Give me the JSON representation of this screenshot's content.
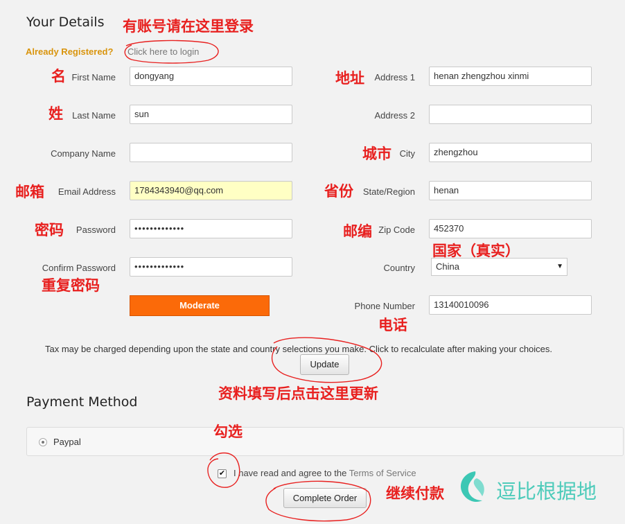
{
  "details": {
    "title": "Your Details",
    "already_registered": "Already Registered?",
    "login_link": "Click here to login"
  },
  "fields_left": {
    "first_name": {
      "label": "First Name",
      "value": "dongyang"
    },
    "last_name": {
      "label": "Last Name",
      "value": "sun"
    },
    "company_name": {
      "label": "Company Name",
      "value": ""
    },
    "email": {
      "label": "Email Address",
      "value": "1784343940@qq.com"
    },
    "password": {
      "label": "Password",
      "value": "•••••••••••••"
    },
    "confirm_password": {
      "label": "Confirm Password",
      "value": "•••••••••••••"
    },
    "strength": "Moderate"
  },
  "fields_right": {
    "address1": {
      "label": "Address 1",
      "value": "henan zhengzhou xinmi"
    },
    "address2": {
      "label": "Address 2",
      "value": ""
    },
    "city": {
      "label": "City",
      "value": "zhengzhou"
    },
    "state": {
      "label": "State/Region",
      "value": "henan"
    },
    "zip": {
      "label": "Zip Code",
      "value": "452370"
    },
    "country": {
      "label": "Country",
      "value": "China"
    },
    "phone": {
      "label": "Phone Number",
      "value": "13140010096"
    }
  },
  "tax_note": "Tax may be charged depending upon the state and country selections you make. Click to recalculate after making your choices.",
  "update_label": "Update",
  "payment": {
    "title": "Payment Method",
    "option": "Paypal"
  },
  "agree": {
    "text": "I have read and agree to the",
    "link": "Terms of Service"
  },
  "complete_label": "Complete Order",
  "annotations": {
    "login": "有账号请在这里登录",
    "first_name": "名",
    "last_name": "姓",
    "email": "邮箱",
    "password": "密码",
    "confirm_password": "重复密码",
    "address": "地址",
    "city": "城市",
    "state": "省份",
    "zip": "邮编",
    "country": "国家（真实）",
    "phone": "电话",
    "update": "资料填写后点击这里更新",
    "check": "勾选",
    "continue": "继续付款"
  },
  "watermark": "逗比根据地",
  "colors": {
    "accent_orange": "#fb6a09",
    "annotation_red": "#e8201f",
    "registered_gold": "#d9940c",
    "watermark_teal": "#3cc7b4"
  }
}
